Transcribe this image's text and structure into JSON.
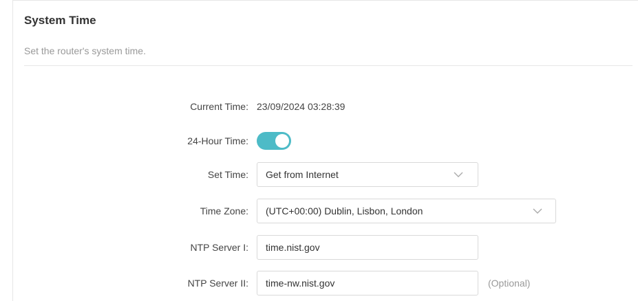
{
  "header": {
    "title": "System Time",
    "subtitle": "Set the router's system time."
  },
  "form": {
    "current_time": {
      "label": "Current Time:",
      "value": "23/09/2024 03:28:39"
    },
    "hour24": {
      "label": "24-Hour Time:",
      "enabled": true
    },
    "set_time": {
      "label": "Set Time:",
      "value": "Get from Internet"
    },
    "time_zone": {
      "label": "Time Zone:",
      "value": "(UTC+00:00) Dublin, Lisbon, London"
    },
    "ntp1": {
      "label": "NTP Server I:",
      "value": "time.nist.gov"
    },
    "ntp2": {
      "label": "NTP Server II:",
      "value": "time-nw.nist.gov",
      "hint": "(Optional)"
    }
  },
  "colors": {
    "accent": "#4dbbc7",
    "border": "#d9d9d9",
    "muted_text": "#999999"
  },
  "icons": {
    "dropdown": "chevron-down-icon"
  }
}
